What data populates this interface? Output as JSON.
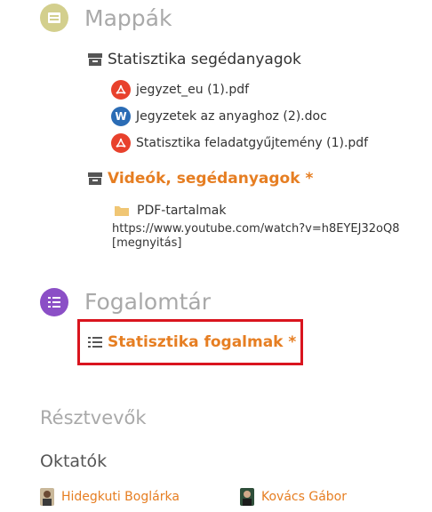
{
  "folders_section": {
    "title": "Mappák",
    "icon": "archive-icon",
    "color": "#d3cf8d"
  },
  "folder1": {
    "label": "Statisztika segédanyagok",
    "files": [
      {
        "name": "jegyzet_eu (1).pdf",
        "type": "pdf"
      },
      {
        "name": "Jegyzetek az anyaghoz (2).doc",
        "type": "doc"
      },
      {
        "name": "Statisztika feladatgyűjtemény (1).pdf",
        "type": "pdf"
      }
    ]
  },
  "folder2": {
    "label": "Videók, segédanyagok *",
    "subfolder": "PDF-tartalmak",
    "url": "https://www.youtube.com/watch?v=h8EYEJ32oQ8",
    "url_open": "[megnyitás]"
  },
  "glossary_section": {
    "title": "Fogalomtár",
    "icon": "list-icon",
    "color": "#8b4fc6"
  },
  "glossary_item": {
    "label": "Statisztika fogalmak *"
  },
  "participants": {
    "title": "Résztvevők",
    "teachers_title": "Oktatók",
    "teachers": [
      {
        "name": "Hidegkuti Boglárka"
      },
      {
        "name": "Kovács Gábor"
      }
    ]
  },
  "colors": {
    "accent": "#e67e22",
    "pdf_red": "#e8412c",
    "doc_blue": "#2b6cb5",
    "highlight": "#d9141e"
  }
}
